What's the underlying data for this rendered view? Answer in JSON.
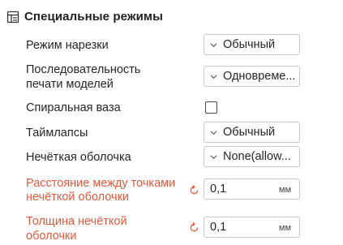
{
  "section": {
    "title": "Специальные режимы",
    "icon": "settings-panel-icon"
  },
  "rows": {
    "slice_mode": {
      "label": "Режим нарезки",
      "value": "Обычный"
    },
    "print_sequence": {
      "label_line1": "Последовательность",
      "label_line2": "печати моделей",
      "value": "Одновреме..."
    },
    "spiral_vase": {
      "label": "Спиральная ваза",
      "checked": false
    },
    "timelapse": {
      "label": "Таймлапсы",
      "value": "Обычный"
    },
    "fuzzy_skin": {
      "label": "Нечёткая оболочка",
      "value": "None(allow..."
    },
    "fuzzy_point_dist": {
      "label_line1": "Расстояние между точками",
      "label_line2": "нечёткой оболочки",
      "value": "0,1",
      "unit": "мм"
    },
    "fuzzy_thickness": {
      "label_line1": "Толщина нечёткой",
      "label_line2": "оболочки",
      "value": "0,1",
      "unit": "мм"
    }
  },
  "colors": {
    "modified_label": "#e8583d",
    "reset_icon": "#e8583d",
    "border": "#c8c8c8"
  },
  "icons": {
    "dropdown": "chevron-down-icon",
    "reset": "reset-arrow-icon"
  }
}
